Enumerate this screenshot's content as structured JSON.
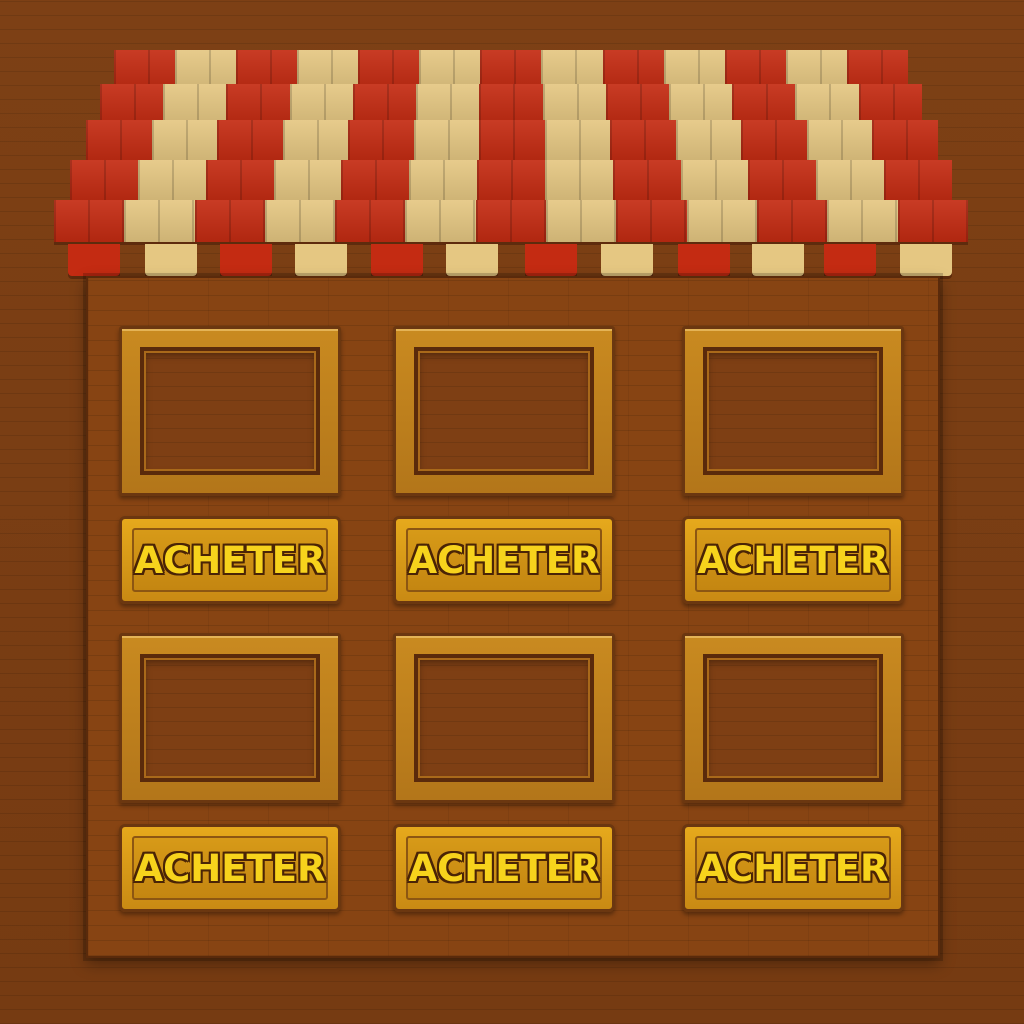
{
  "awning": {
    "stripe_colors": [
      "red",
      "cream",
      "red",
      "cream",
      "red",
      "cream",
      "red",
      "cream",
      "red",
      "cream",
      "red",
      "cream",
      "red"
    ],
    "colors": {
      "red": "#c42b12",
      "cream": "#e5c782"
    }
  },
  "shop": {
    "items": [
      {
        "slot_name": "item-slot-1",
        "button_label": "ACHETER"
      },
      {
        "slot_name": "item-slot-2",
        "button_label": "ACHETER"
      },
      {
        "slot_name": "item-slot-3",
        "button_label": "ACHETER"
      },
      {
        "slot_name": "item-slot-4",
        "button_label": "ACHETER"
      },
      {
        "slot_name": "item-slot-5",
        "button_label": "ACHETER"
      },
      {
        "slot_name": "item-slot-6",
        "button_label": "ACHETER"
      }
    ]
  },
  "colors": {
    "wood_background": "#7a3e14",
    "board": "#874413",
    "frame_gold": "#c98a20",
    "button_gold": "#e6a91c",
    "label_yellow": "#f7d31c"
  }
}
